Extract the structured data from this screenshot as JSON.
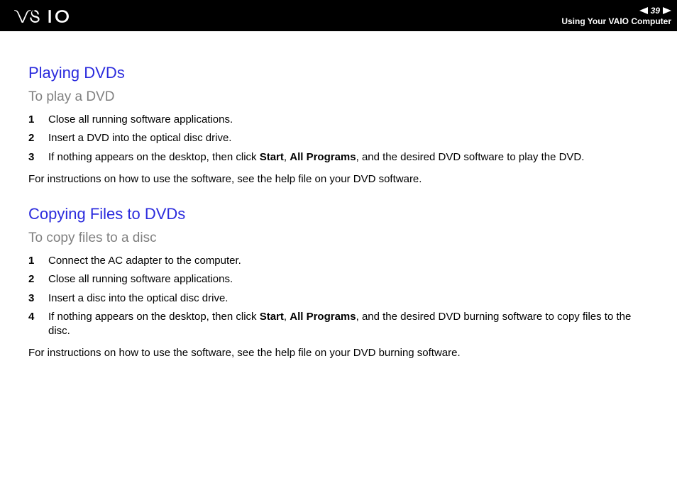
{
  "header": {
    "page_number": "39",
    "section_label": "Using Your VAIO Computer"
  },
  "sections": [
    {
      "heading": "Playing DVDs",
      "subheading": "To play a DVD",
      "steps": [
        {
          "n": "1",
          "text": "Close all running software applications."
        },
        {
          "n": "2",
          "text": "Insert a DVD into the optical disc drive."
        },
        {
          "n": "3",
          "text_pre": "If nothing appears on the desktop, then click ",
          "b1": "Start",
          "sep1": ", ",
          "b2": "All Programs",
          "text_post": ", and the desired DVD software to play the DVD."
        }
      ],
      "footer": "For instructions on how to use the software, see the help file on your DVD software."
    },
    {
      "heading": "Copying Files to DVDs",
      "subheading": "To copy files to a disc",
      "steps": [
        {
          "n": "1",
          "text": "Connect the AC adapter to the computer."
        },
        {
          "n": "2",
          "text": "Close all running software applications."
        },
        {
          "n": "3",
          "text": "Insert a disc into the optical disc drive."
        },
        {
          "n": "4",
          "text_pre": "If nothing appears on the desktop, then click ",
          "b1": "Start",
          "sep1": ", ",
          "b2": "All Programs",
          "text_post": ", and the desired DVD burning software to copy files to the disc."
        }
      ],
      "footer": "For instructions on how to use the software, see the help file on your DVD burning software."
    }
  ]
}
